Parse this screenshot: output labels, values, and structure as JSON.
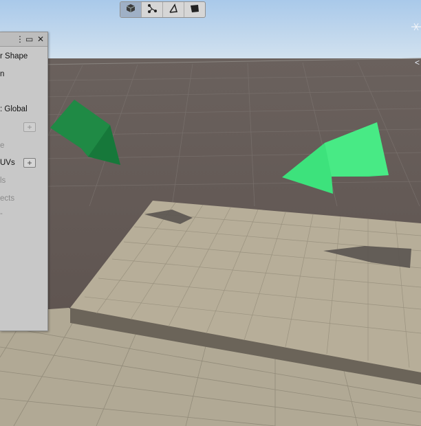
{
  "toolbar": {
    "tools": [
      {
        "icon": "cube-object-mode-icon",
        "active": true
      },
      {
        "icon": "vertex-mode-icon",
        "active": false
      },
      {
        "icon": "edge-mode-icon",
        "active": false
      },
      {
        "icon": "face-mode-icon",
        "active": false
      }
    ]
  },
  "panel": {
    "header": {
      "menu_glyph": "⋮",
      "maximize_glyph": "▭",
      "close_glyph": "✕"
    },
    "items": [
      {
        "label": "r Shape"
      },
      {
        "label": "n"
      },
      {
        "label": ": Global"
      },
      {
        "label": "e"
      },
      {
        "label": "UVs"
      },
      {
        "label": "ls"
      },
      {
        "label": "ects"
      },
      {
        "label": "-"
      }
    ],
    "plus_label": "+"
  },
  "colors": {
    "sky": "#bcd6ee",
    "ground_plane": "#5f5552",
    "floor_tile": "#b3ab96",
    "arrow_dark": "#1f8a45",
    "arrow_bright": "#3de27c",
    "panel_bg": "#c8c8c8"
  }
}
